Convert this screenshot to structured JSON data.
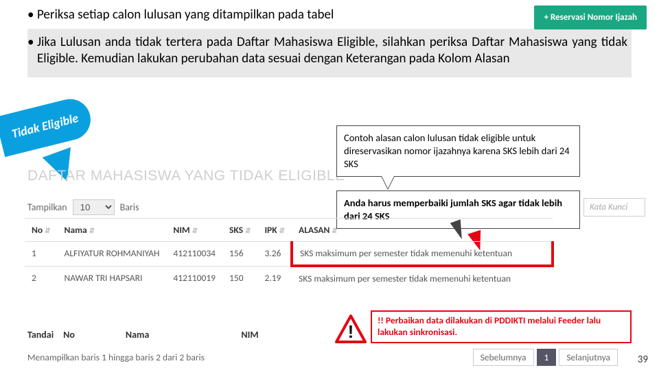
{
  "btn_reserve": "+ Reservasi Nomor Ijazah",
  "bullet1": "Periksa setiap calon lulusan yang ditampilkan pada tabel",
  "bullet2": "Jika Lulusan anda tidak tertera pada Daftar Mahasiswa Eligible, silahkan periksa Daftar Mahasiswa yang tidak Eligible. Kemudian lakukan perubahan data sesuai dengan Keterangan pada Kolom Alasan",
  "tidak_badge": "Tidak Eligible",
  "title_daftar": "DAFTAR MAHASISWA YANG TIDAK ELIGIBLE",
  "callout1": "Contoh alasan calon lulusan tidak eligible untuk direservasikan nomor ijazahnya karena SKS lebih dari 24 SKS",
  "callout2": "Anda harus memperbaiki jumlah SKS agar tidak lebih dari 24 SKS",
  "search_placeholder": "Kata Kunci",
  "tampilkan_pre": "Tampilkan",
  "tampilkan_val": "10",
  "tampilkan_post": "Baris",
  "headers": {
    "no": "No",
    "nama": "Nama",
    "nim": "NIM",
    "sks": "SKS",
    "ipk": "IPK",
    "alasan": "ALASAN"
  },
  "rows": [
    {
      "no": "1",
      "nama": "ALFIYATUR ROHMANIYAH",
      "nim": "412110034",
      "sks": "156",
      "ipk": "3.26",
      "alasan": "SKS maksimum per semester tidak memenuhi ketentuan"
    },
    {
      "no": "2",
      "nama": "NAWAR TRI HAPSARI",
      "nim": "412110019",
      "sks": "150",
      "ipk": "2.19",
      "alasan": "SKS maksimum per semester tidak memenuhi ketentuan"
    }
  ],
  "footer_headers": {
    "tandai": "Tandai",
    "no": "No",
    "nama": "Nama",
    "nim": "NIM"
  },
  "warn_text": "!! Perbaikan data dilakukan di PDDIKTI melalui Feeder lalu lakukan sinkronisasi.",
  "bot_info": "Menampilkan baris 1 hingga baris 2 dari 2 baris",
  "pager": {
    "prev": "Sebelumnya",
    "one": "1",
    "next": "Selanjutnya"
  },
  "page_number": "39"
}
